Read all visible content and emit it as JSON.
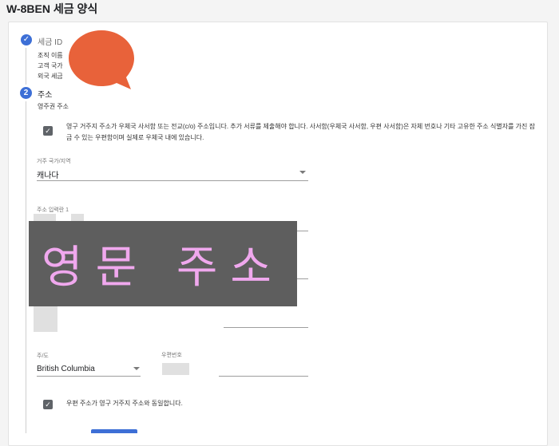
{
  "title": "W-8BEN 세금 양식",
  "step1": {
    "title": "세금 ID",
    "lines": [
      "조직 이름",
      "고객 국가",
      "외국 세금"
    ]
  },
  "step2": {
    "number": "2",
    "title": "주소",
    "subtitle": "영주권 주소"
  },
  "po_box_checkbox": {
    "text": "영구 거주지 주소가 우체국 사서함 또는 전교(c/o) 주소입니다. 추가 서류를 제출해야 합니다. 사서함(우체국 사서함, 우편 사서함)은 자체 번호나 기타 고유한 주소 식별자를 가진 잠금 수 있는 우편함이며 실제로 우체국 내에 있습니다."
  },
  "country_field": {
    "label": "거주 국가/지역",
    "value": "캐나다"
  },
  "address_line1": {
    "label": "주소 입력란 1"
  },
  "overlay": {
    "text": "영문 주소",
    "color": "#f0a8ee"
  },
  "state_field": {
    "label": "주/도",
    "value": "British Columbia"
  },
  "postal_field": {
    "label": "우편번호"
  },
  "same_address_checkbox": {
    "text": "우편 주소가 영구 거주지 주소와 동일합니다."
  },
  "colors": {
    "accent": "#3d6fd6",
    "blob": "#e8623a"
  }
}
